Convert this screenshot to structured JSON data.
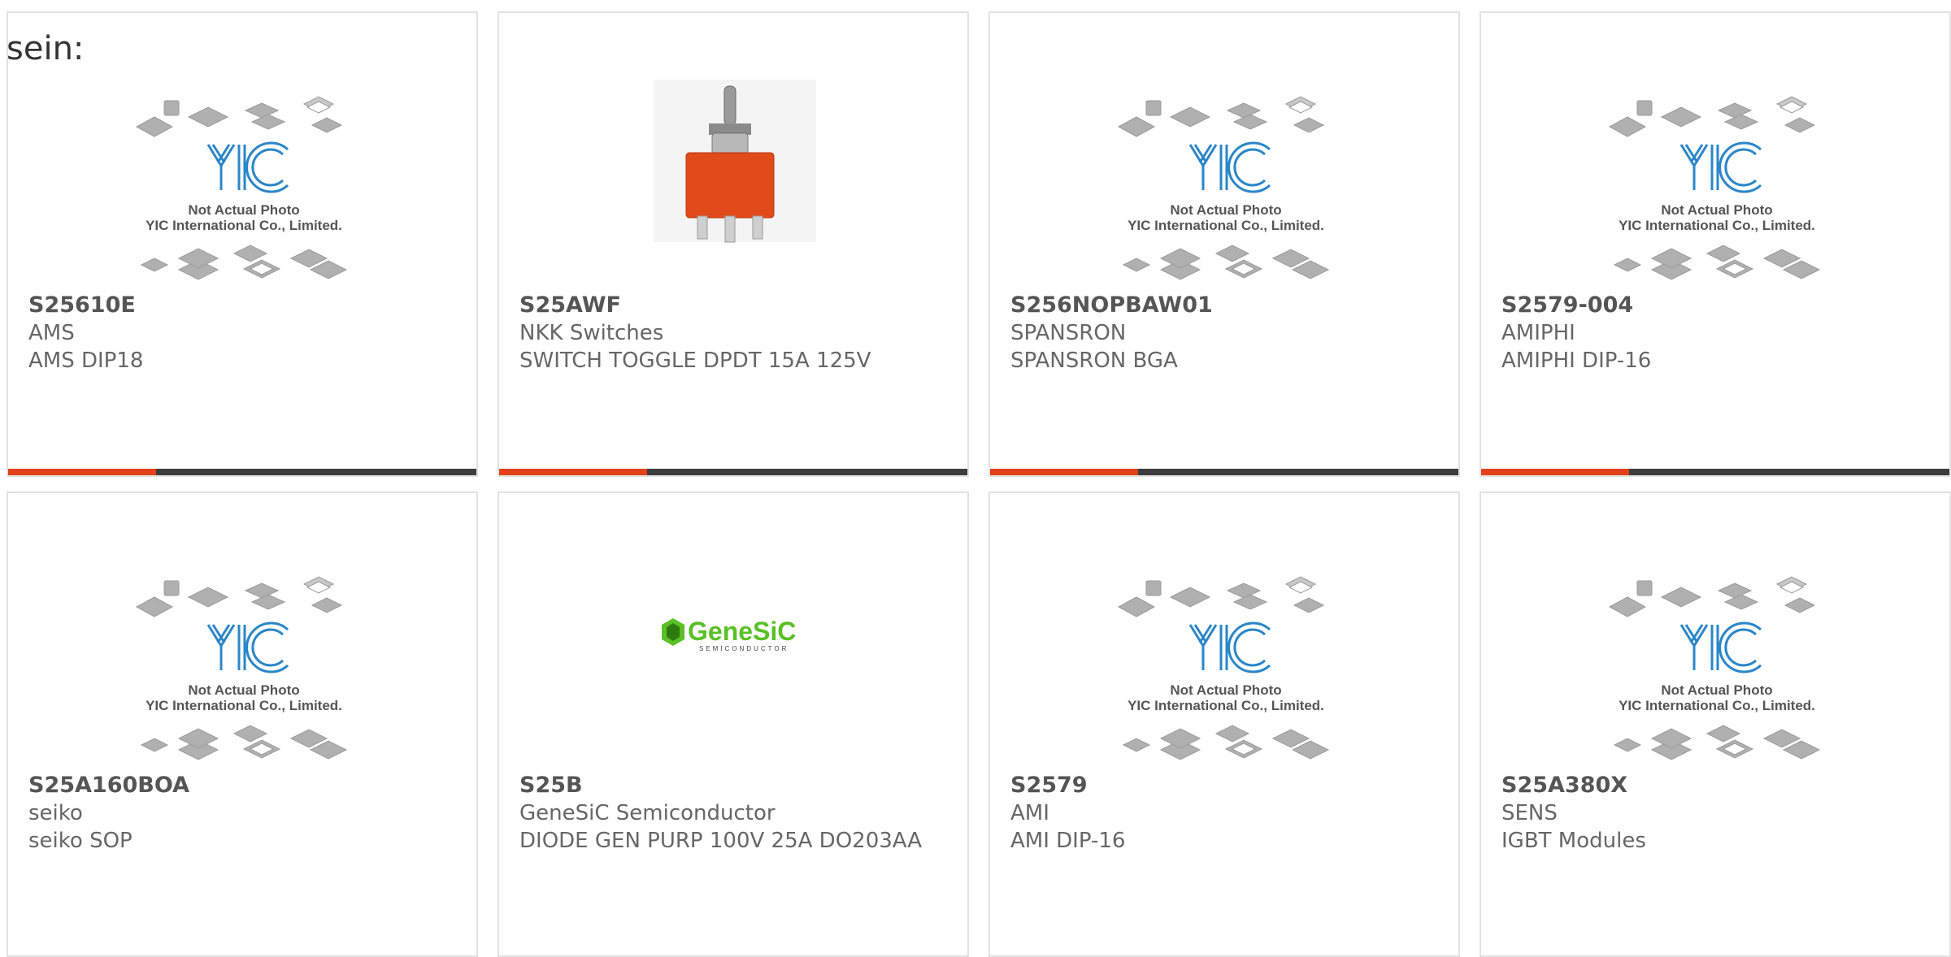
{
  "lead_text": "sein:",
  "image_caption": {
    "line1": "Not Actual Photo",
    "line2": "YIC International Co., Limited.",
    "logo": "YIC"
  },
  "genesic_logo": {
    "name": "GeneSiC",
    "sub": "SEMICONDUCTOR"
  },
  "colors": {
    "accent": "#e4411b",
    "bar_dark": "#3d3d3d",
    "logo_blue": "#2a86c8",
    "genesic_green": "#5ac026"
  },
  "products": [
    {
      "pn": "S25610E",
      "manufacturer": "AMS",
      "desc": "AMS DIP18",
      "image": "placeholder"
    },
    {
      "pn": "S25AWF",
      "manufacturer": "NKK Switches",
      "desc": "SWITCH TOGGLE DPDT 15A 125V",
      "image": "toggle-switch"
    },
    {
      "pn": "S256NOPBAW01",
      "manufacturer": "SPANSRON",
      "desc": "SPANSRON BGA",
      "image": "placeholder"
    },
    {
      "pn": "S2579-004",
      "manufacturer": "AMIPHI",
      "desc": "AMIPHI DIP-16",
      "image": "placeholder"
    },
    {
      "pn": "S25A160BOA",
      "manufacturer": "seiko",
      "desc": "seiko SOP",
      "image": "placeholder"
    },
    {
      "pn": "S25B",
      "manufacturer": "GeneSiC Semiconductor",
      "desc": "DIODE GEN PURP 100V 25A DO203AA",
      "image": "genesic-logo"
    },
    {
      "pn": "S2579",
      "manufacturer": "AMI",
      "desc": "AMI DIP-16",
      "image": "placeholder"
    },
    {
      "pn": "S25A380X",
      "manufacturer": "SENS",
      "desc": "IGBT Modules",
      "image": "placeholder"
    }
  ]
}
